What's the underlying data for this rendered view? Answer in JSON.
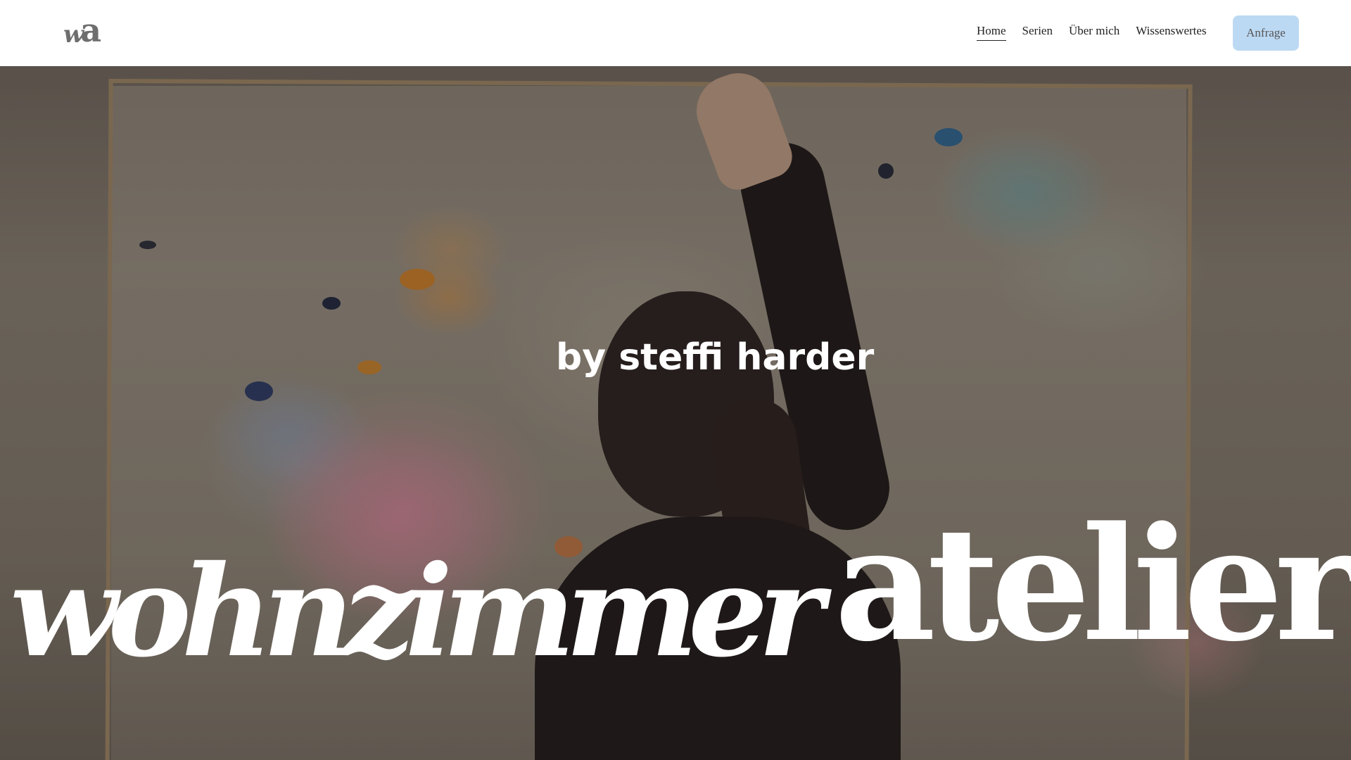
{
  "header": {
    "logo_w": "w",
    "logo_a": "a",
    "nav": [
      {
        "label": "Home",
        "active": true
      },
      {
        "label": "Serien",
        "active": false
      },
      {
        "label": "Über mich",
        "active": false
      },
      {
        "label": "Wissenswertes",
        "active": false
      }
    ],
    "cta_label": "Anfrage",
    "cta_color": "#bcd9f3"
  },
  "hero": {
    "title_script": "wohnzimmer",
    "title_serif": "atelier",
    "subtitle": "by steffi harder",
    "text_color": "#ffffff"
  }
}
